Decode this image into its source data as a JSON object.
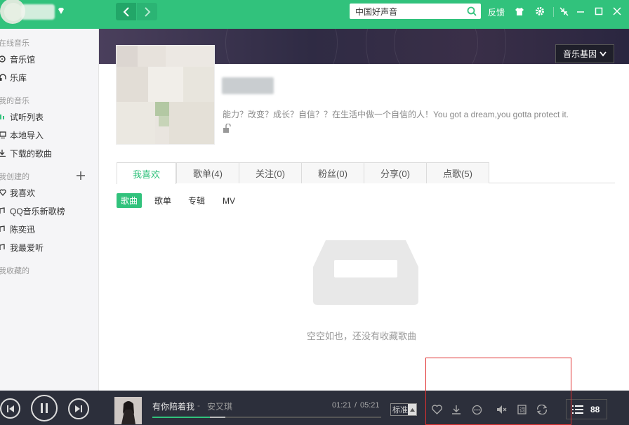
{
  "topbar": {
    "back_label": "‹",
    "forward_label": "›",
    "search_value": "中国好声音",
    "feedback_label": "反馈"
  },
  "sidebar": {
    "sections": [
      {
        "title": "在线音乐",
        "items": [
          {
            "label": "音乐馆",
            "icon": "disc-icon"
          },
          {
            "label": "乐库",
            "icon": "headphones-icon"
          }
        ]
      },
      {
        "title": "我的音乐",
        "items": [
          {
            "label": "试听列表",
            "icon": "bars-icon"
          },
          {
            "label": "本地导入",
            "icon": "monitor-icon"
          },
          {
            "label": "下载的歌曲",
            "icon": "download-icon"
          }
        ]
      },
      {
        "title": "我创建的",
        "items": [
          {
            "label": "我喜欢",
            "icon": "heart-icon"
          },
          {
            "label": "QQ音乐新歌榜",
            "icon": "note-icon"
          },
          {
            "label": "陈奕迅",
            "icon": "note-icon"
          },
          {
            "label": "我最爱听",
            "icon": "note-icon"
          }
        ]
      },
      {
        "title": "我收藏的",
        "items": []
      }
    ]
  },
  "profile": {
    "gene_button": "音乐基因",
    "bio": "能力？改变？成长？自信？？在生活中做一个自信的人！You got a dream,you gotta protect it."
  },
  "tabs": [
    "我喜欢",
    "歌单(4)",
    "关注(0)",
    "粉丝(0)",
    "分享(0)",
    "点歌(5)"
  ],
  "subtabs": [
    "歌曲",
    "歌单",
    "专辑",
    "MV"
  ],
  "empty_text": "空空如也，还没有收藏歌曲",
  "player": {
    "song_title": "有你陪着我",
    "separator": "-",
    "artist": "安又琪",
    "current_time": "01:21",
    "time_sep": "/",
    "total_time": "05:21",
    "progress": 0.25,
    "buffered": 0.32,
    "quality": "标准",
    "playlist_count": "88"
  },
  "colors": {
    "accent": "#31c27c",
    "player_bg": "#2c2f3b",
    "sidebar_bg": "#f5f5f7"
  }
}
